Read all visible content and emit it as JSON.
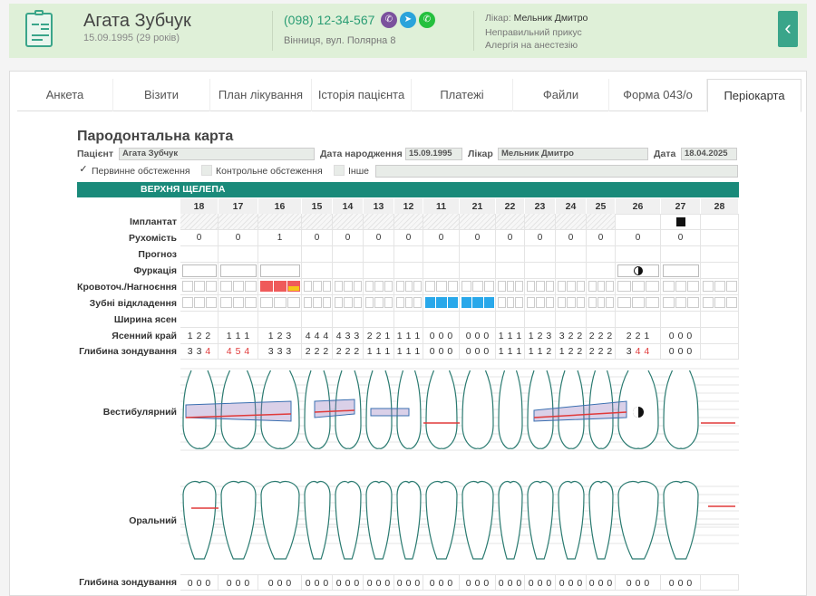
{
  "header": {
    "patient_name": "Агата Зубчук",
    "dob_age": "15.09.1995 (29 років)",
    "phone": "(098) 12-34-567",
    "address": "Вінниця, вул. Полярна 8",
    "doctor_label": "Лікар:",
    "doctor_name": "Мельник Дмитро",
    "note1": "Неправильний прикус",
    "note2": "Алергія на анестезію",
    "back_glyph": "‹"
  },
  "messengers": [
    {
      "name": "viber",
      "glyph": "✆",
      "color": "#7b519d"
    },
    {
      "name": "telegram",
      "glyph": "➤",
      "color": "#2aa3db"
    },
    {
      "name": "whatsapp",
      "glyph": "✆",
      "color": "#25c03e"
    }
  ],
  "tabs": [
    {
      "label": "Анкета"
    },
    {
      "label": "Візити"
    },
    {
      "label": "План лікування"
    },
    {
      "label": "Історія пацієнта"
    },
    {
      "label": "Платежі"
    },
    {
      "label": "Файли"
    },
    {
      "label": "Форма 043/о"
    },
    {
      "label": "Періокарта",
      "active": true
    }
  ],
  "form": {
    "title": "Пародонтальна карта",
    "patient_label": "Пацієнт",
    "patient_value": "Агата Зубчук",
    "dob_label": "Дата народження",
    "dob_value": "15.09.1995",
    "doctor_label": "Лікар",
    "doctor_value": "Мельник Дмитро",
    "date_label": "Дата",
    "date_value": "18.04.2025",
    "check_primary": "Первинне обстеження",
    "check_primary_mark": "✓",
    "check_control": "Контрольне обстеження",
    "check_other": "Інше",
    "jaw_title": "ВЕРХНЯ ЩЕЛЕПА"
  },
  "teeth": [
    "18",
    "17",
    "16",
    "15",
    "14",
    "13",
    "12",
    "11",
    "21",
    "22",
    "23",
    "24",
    "25",
    "26",
    "27",
    "28"
  ],
  "row_labels": {
    "implant": "Імплантат",
    "mobility": "Рухомість",
    "prognosis": "Прогноз",
    "furcation": "Фуркація",
    "bleeding": "Кровоточ./Нагноєння",
    "plaque": "Зубні відкладення",
    "gingiva_width": "Ширина ясен",
    "gingival_margin": "Ясенний край",
    "probing_depth": "Глибина зондування",
    "vestibular": "Вестибулярний",
    "oral": "Оральний",
    "probing_depth_bottom": "Глибина зондування"
  },
  "mobility": [
    "0",
    "0",
    "1",
    "0",
    "0",
    "0",
    "0",
    "0",
    "0",
    "0",
    "0",
    "0",
    "0",
    "0",
    "0",
    ""
  ],
  "gingival_margin": [
    [
      "1",
      "2",
      "2"
    ],
    [
      "1",
      "1",
      "1"
    ],
    [
      "1",
      "2",
      "3"
    ],
    [
      "4",
      "4",
      "4"
    ],
    [
      "4",
      "3",
      "3"
    ],
    [
      "2",
      "2",
      "1"
    ],
    [
      "1",
      "1",
      "1"
    ],
    [
      "0",
      "0",
      "0"
    ],
    [
      "0",
      "0",
      "0"
    ],
    [
      "1",
      "1",
      "1"
    ],
    [
      "1",
      "2",
      "3"
    ],
    [
      "3",
      "2",
      "2"
    ],
    [
      "2",
      "2",
      "2"
    ],
    [
      "2",
      "2",
      "1"
    ],
    [
      "0",
      "0",
      "0"
    ],
    [
      "",
      "",
      ""
    ]
  ],
  "probing_depth": [
    [
      "3",
      "3",
      "4"
    ],
    [
      "4",
      "5",
      "4"
    ],
    [
      "3",
      "3",
      "3"
    ],
    [
      "2",
      "2",
      "2"
    ],
    [
      "2",
      "2",
      "2"
    ],
    [
      "1",
      "1",
      "1"
    ],
    [
      "1",
      "1",
      "1"
    ],
    [
      "0",
      "0",
      "0"
    ],
    [
      "0",
      "0",
      "0"
    ],
    [
      "1",
      "1",
      "1"
    ],
    [
      "1",
      "1",
      "2"
    ],
    [
      "1",
      "2",
      "2"
    ],
    [
      "2",
      "2",
      "2"
    ],
    [
      "3",
      "4",
      "4"
    ],
    [
      "0",
      "0",
      "0"
    ],
    [
      "",
      "",
      ""
    ]
  ],
  "probing_depth_red": [
    [
      false,
      false,
      true
    ],
    [
      true,
      true,
      true
    ],
    [
      false,
      false,
      false
    ],
    [
      false,
      false,
      false
    ],
    [
      false,
      false,
      false
    ],
    [
      false,
      false,
      false
    ],
    [
      false,
      false,
      false
    ],
    [
      false,
      false,
      false
    ],
    [
      false,
      false,
      false
    ],
    [
      false,
      false,
      false
    ],
    [
      false,
      false,
      false
    ],
    [
      false,
      false,
      false
    ],
    [
      false,
      false,
      false
    ],
    [
      false,
      true,
      true
    ],
    [
      false,
      false,
      false
    ],
    [
      false,
      false,
      false
    ]
  ],
  "probing_depth_bottom": [
    [
      "0",
      "0",
      "0"
    ],
    [
      "0",
      "0",
      "0"
    ],
    [
      "0",
      "0",
      "0"
    ],
    [
      "0",
      "0",
      "0"
    ],
    [
      "0",
      "0",
      "0"
    ],
    [
      "0",
      "0",
      "0"
    ],
    [
      "0",
      "0",
      "0"
    ],
    [
      "0",
      "0",
      "0"
    ],
    [
      "0",
      "0",
      "0"
    ],
    [
      "0",
      "0",
      "0"
    ],
    [
      "0",
      "0",
      "0"
    ],
    [
      "0",
      "0",
      "0"
    ],
    [
      "0",
      "0",
      "0"
    ],
    [
      "0",
      "0",
      "0"
    ],
    [
      "0",
      "0",
      "0"
    ],
    [
      "",
      "",
      ""
    ]
  ],
  "bleeding": [
    [
      0,
      0,
      0
    ],
    [
      0,
      0,
      0
    ],
    [
      1,
      1,
      2
    ],
    [
      0,
      0,
      0
    ],
    [
      0,
      0,
      0
    ],
    [
      0,
      0,
      0
    ],
    [
      0,
      0,
      0
    ],
    [
      0,
      0,
      0
    ],
    [
      0,
      0,
      0
    ],
    [
      0,
      0,
      0
    ],
    [
      0,
      0,
      0
    ],
    [
      0,
      0,
      0
    ],
    [
      0,
      0,
      0
    ],
    [
      0,
      0,
      0
    ],
    [
      0,
      0,
      0
    ],
    [
      0,
      0,
      0
    ]
  ],
  "plaque": [
    [
      0,
      0,
      0
    ],
    [
      0,
      0,
      0
    ],
    [
      0,
      0,
      0
    ],
    [
      0,
      0,
      0
    ],
    [
      0,
      0,
      0
    ],
    [
      0,
      0,
      0
    ],
    [
      0,
      0,
      0
    ],
    [
      1,
      1,
      1
    ],
    [
      1,
      1,
      1
    ],
    [
      0,
      0,
      0
    ],
    [
      0,
      0,
      0
    ],
    [
      0,
      0,
      0
    ],
    [
      0,
      0,
      0
    ],
    [
      0,
      0,
      0
    ],
    [
      0,
      0,
      0
    ],
    [
      0,
      0,
      0
    ]
  ],
  "implant_teeth": [
    "27"
  ],
  "furcation_marks": {
    "26": "half"
  },
  "furcation_teeth": [
    "18",
    "17",
    "16",
    "26",
    "27"
  ],
  "colors": {
    "accent": "#3aa58a",
    "jaw_bar": "#1a8a7a",
    "red": "#ef5a5a",
    "blue": "#29a8ea"
  }
}
